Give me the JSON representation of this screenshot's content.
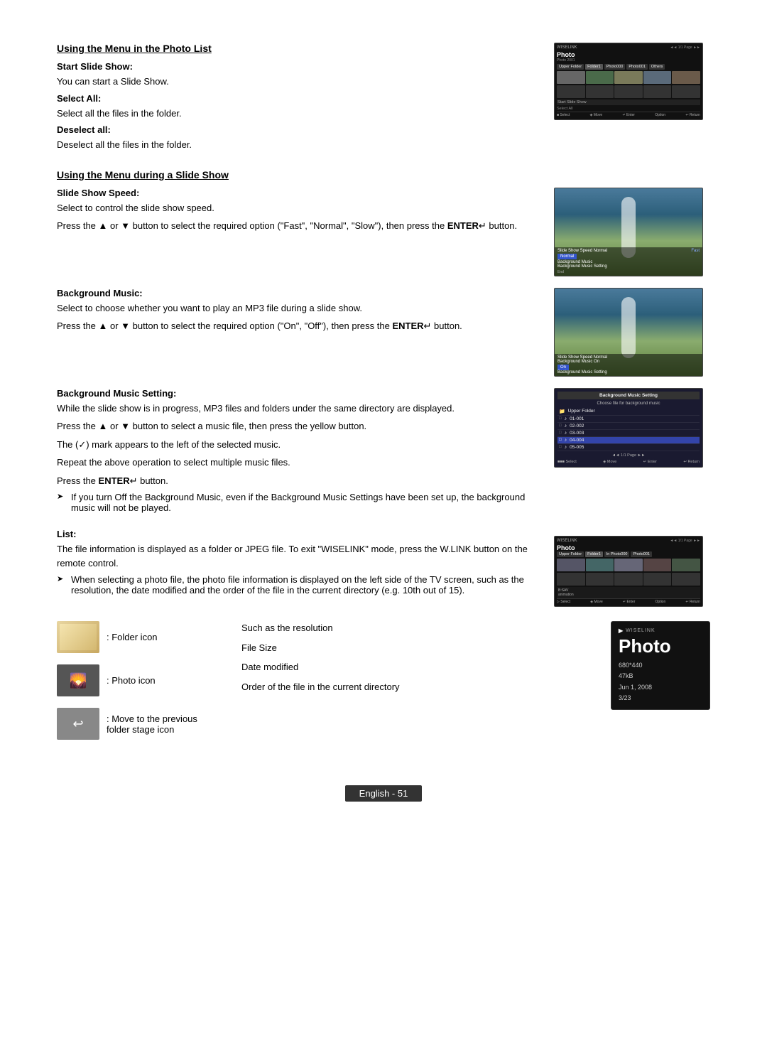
{
  "page": {
    "title": "Using the Menu in the Photo List",
    "section1": {
      "title": "Using the Menu in the Photo List",
      "subsections": [
        {
          "id": "start-slide-show",
          "title": "Start Slide Show:",
          "body": "You can start a Slide Show."
        },
        {
          "id": "select-all",
          "title": "Select All:",
          "body": "Select all the files in the folder."
        },
        {
          "id": "deselect-all",
          "title": "Deselect all:",
          "body": "Deselect all the files in the folder."
        }
      ]
    },
    "section2": {
      "title": "Using the Menu during a Slide Show",
      "subsections": [
        {
          "id": "slide-show-speed",
          "title": "Slide Show Speed:",
          "body": "Select to control the slide show speed.",
          "detail1": "Press the ▲ or ▼ button to select the required option (\"Fast\", \"Normal\", \"Slow\"), then press the ENTER",
          "detail1_suffix": " button."
        },
        {
          "id": "background-music",
          "title": "Background Music:",
          "body": "Select to choose whether you want to play an MP3 file during a slide show.",
          "detail1": "Press the ▲ or ▼ button to select the required option (\"On\", \"Off\"), then press the ENTER",
          "detail1_suffix": " button."
        },
        {
          "id": "background-music-setting",
          "title": "Background Music Setting:",
          "body": "While the slide show is in progress, MP3 files and folders under the same directory are displayed.",
          "detail1": "Press the ▲ or ▼ button to select a music file, then press the yellow button.",
          "detail2": "The (✓) mark appears to the left of the selected music.",
          "detail3": "Repeat the above operation to select multiple music files.",
          "detail4": "Press the ENTER",
          "detail4_suffix": " button.",
          "note": "If you turn Off the Background Music, even if the Background Music Settings have been set up, the background music will not be played."
        },
        {
          "id": "list",
          "title": "List:",
          "body": "The file information is displayed as a folder or JPEG file. To exit \"WISELINK\" mode, press the W.LINK button on the remote control.",
          "note": "When selecting a photo file, the photo file information is displayed on the left side of the TV screen, such as the resolution, the date modified and the order of the file in the current directory (e.g. 10th out of 15)."
        }
      ]
    },
    "icon_legend": {
      "items": [
        {
          "id": "folder-icon",
          "label": ": Folder icon"
        },
        {
          "id": "photo-icon",
          "label": ": Photo icon"
        },
        {
          "id": "back-icon",
          "label": ": Move to the previous folder stage icon"
        }
      ]
    },
    "annotation": {
      "resolution_label": "Such as the resolution",
      "filesize_label": "File Size",
      "date_label": "Date modified",
      "order_label": "Order of the file in the current directory",
      "wiselink_brand": "WISELINK",
      "wiselink_title": "Photo",
      "wiselink_info": "680*440\n47kB\nJun 1, 2008\n3/23"
    },
    "footer": {
      "label": "English - 51"
    },
    "screens": {
      "bgm_rows": [
        {
          "id": "upper-folder",
          "label": "Upper Folder",
          "icon": "📁",
          "selected": false
        },
        {
          "id": "01-001",
          "label": "01-001",
          "icon": "♪",
          "selected": false
        },
        {
          "id": "02-002",
          "label": "02-002",
          "icon": "♪",
          "selected": false
        },
        {
          "id": "03-003",
          "label": "03-003",
          "icon": "♪",
          "selected": false
        },
        {
          "id": "04-004",
          "label": "04-004",
          "icon": "♪",
          "selected": true
        },
        {
          "id": "05-005",
          "label": "05-005",
          "icon": "♪",
          "selected": false
        }
      ],
      "bgm_header": "Background Music Setting",
      "bgm_subheader": "Choose file for background music",
      "bgm_page": "◄◄ 1/1 Page ►►",
      "bgm_footer_select": "■■■ Select",
      "bgm_footer_move": "◈ Move",
      "bgm_footer_enter": "↵ Enter",
      "bgm_footer_return": "↩ Return"
    }
  }
}
